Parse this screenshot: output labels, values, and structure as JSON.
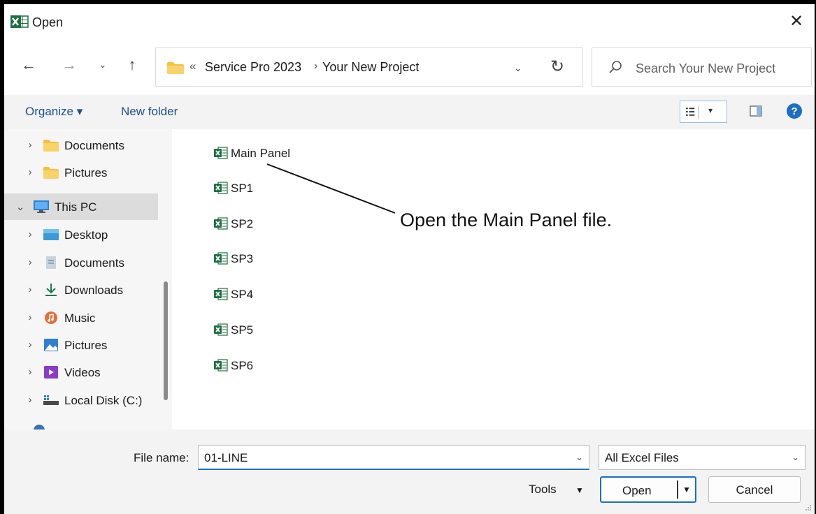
{
  "window": {
    "title": "Open"
  },
  "address": {
    "overflow_glyph": "«",
    "segments": [
      "Service Pro 2023",
      "Your New Project"
    ],
    "separator": "›"
  },
  "search": {
    "placeholder": "Search Your New Project"
  },
  "command_bar": {
    "organize": "Organize ▾",
    "new_folder": "New folder"
  },
  "nav_tree": [
    {
      "label": "Documents",
      "icon": "folder-icon",
      "expanded": false,
      "level": 1
    },
    {
      "label": "Pictures",
      "icon": "folder-icon",
      "expanded": false,
      "level": 1
    },
    {
      "label": "This PC",
      "icon": "monitor-icon",
      "expanded": true,
      "level": 0,
      "selected": true
    },
    {
      "label": "Desktop",
      "icon": "desktop-icon",
      "expanded": false,
      "level": 1
    },
    {
      "label": "Documents",
      "icon": "documents-icon",
      "expanded": false,
      "level": 1
    },
    {
      "label": "Downloads",
      "icon": "download-icon",
      "expanded": false,
      "level": 1
    },
    {
      "label": "Music",
      "icon": "music-icon",
      "expanded": false,
      "level": 1
    },
    {
      "label": "Pictures",
      "icon": "pictures-icon",
      "expanded": false,
      "level": 1
    },
    {
      "label": "Videos",
      "icon": "videos-icon",
      "expanded": false,
      "level": 1
    },
    {
      "label": "Local Disk (C:)",
      "icon": "drive-icon",
      "expanded": false,
      "level": 1
    }
  ],
  "files": [
    "Main Panel",
    "SP1",
    "SP2",
    "SP3",
    "SP4",
    "SP5",
    "SP6"
  ],
  "annotation": {
    "text": "Open the Main Panel file."
  },
  "bottom": {
    "file_name_label": "File name:",
    "file_name_value": "01-LINE",
    "filter_value": "All Excel Files",
    "tools_label": "Tools",
    "open_label": "Open",
    "cancel_label": "Cancel"
  },
  "colors": {
    "accent": "#1b6ec2",
    "excel_green": "#1d6f42",
    "folder_yellow": "#f3c242"
  }
}
